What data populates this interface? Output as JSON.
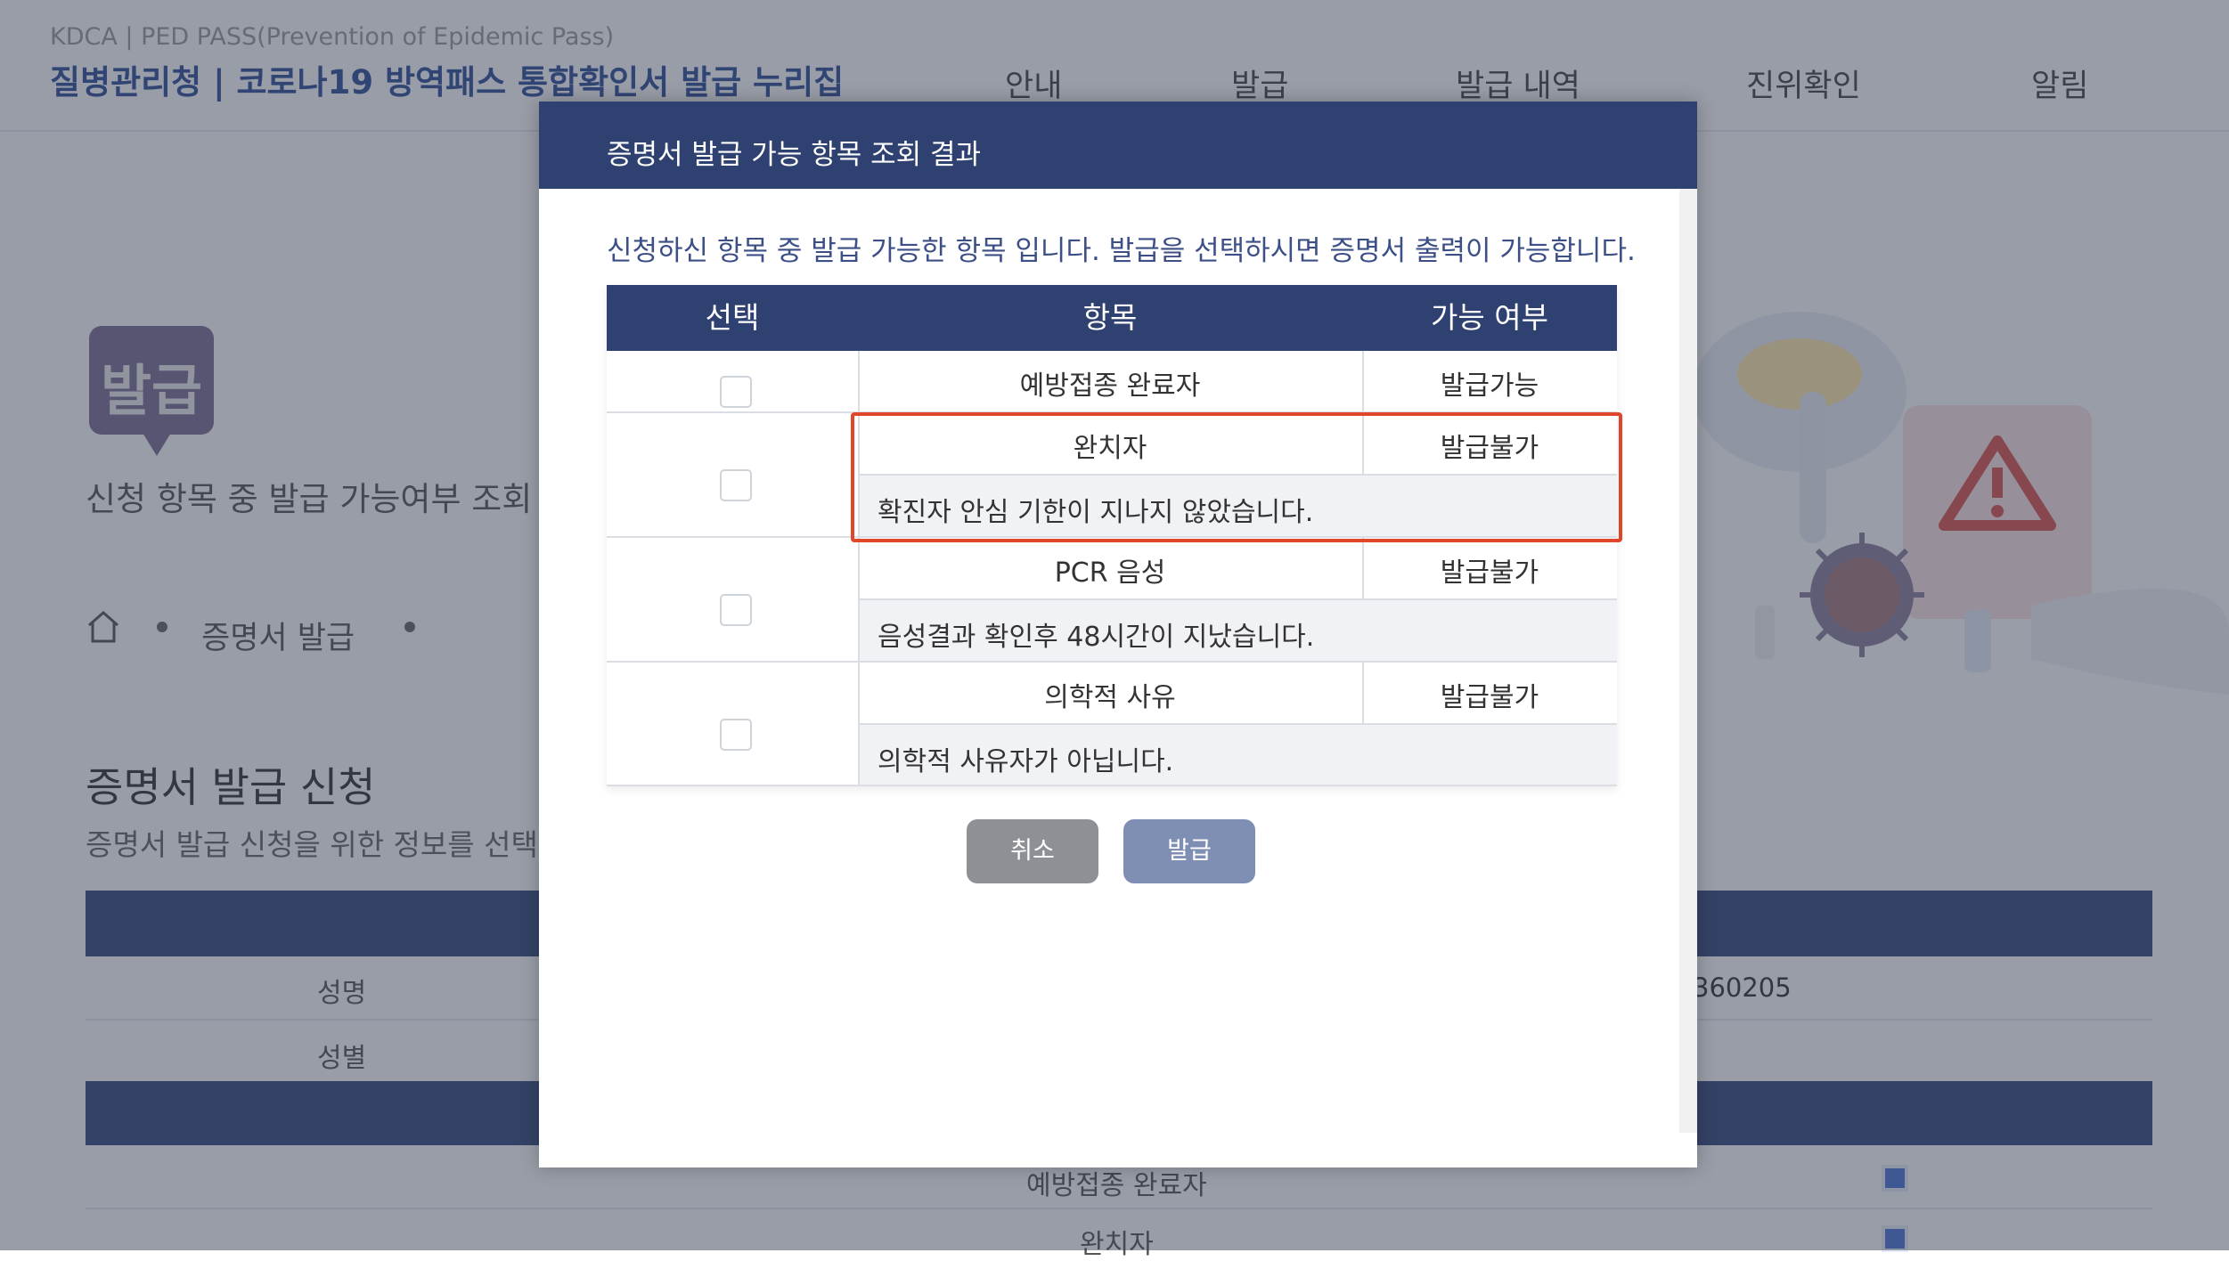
{
  "header": {
    "sub_brand": "KDCA | PED PASS(Prevention of Epidemic Pass)",
    "brand": "질병관리청 | 코로나19 방역패스 통합확인서 발급 누리집",
    "nav": [
      "안내",
      "발급",
      "발급 내역",
      "진위확인",
      "알림"
    ]
  },
  "page": {
    "badge_text": "발급",
    "description": "신청 항목 중 발급 가능여부 조회",
    "breadcrumb": "증명서 발급",
    "section_title": "증명서 발급 신청",
    "section_desc": "증명서 발급 신청을 위한 정보를 선택",
    "form_labels": [
      "성명",
      "성별"
    ],
    "form_values": [
      "360205"
    ],
    "list_items": [
      "예방접종 완료자",
      "완치자"
    ]
  },
  "modal": {
    "title": "증명서 발급 가능 항목 조회 결과",
    "description": "신청하신 항목 중 발급 가능한 항목 입니다. 발급을 선택하시면 증명서 출력이 가능합니다.",
    "columns": [
      "선택",
      "항목",
      "가능 여부"
    ],
    "rows": [
      {
        "item": "예방접종 완료자",
        "status": "발급가능",
        "reason": "",
        "checked": false
      },
      {
        "item": "완치자",
        "status": "발급불가",
        "reason": "확진자 안심 기한이 지나지 않았습니다.",
        "checked": false
      },
      {
        "item": "PCR 음성",
        "status": "발급불가",
        "reason": "음성결과 확인후 48시간이 지났습니다.",
        "checked": false
      },
      {
        "item": "의학적 사유",
        "status": "발급불가",
        "reason": "의학적 사유자가 아닙니다.",
        "checked": false
      }
    ],
    "buttons": {
      "cancel": "취소",
      "issue": "발급"
    }
  },
  "colors": {
    "header_navy": "#2e4170",
    "brand_blue": "#2f4f9a",
    "highlight_red": "#e2462a",
    "cancel_gray": "#8e9096",
    "issue_blue": "#7f8fb3"
  }
}
